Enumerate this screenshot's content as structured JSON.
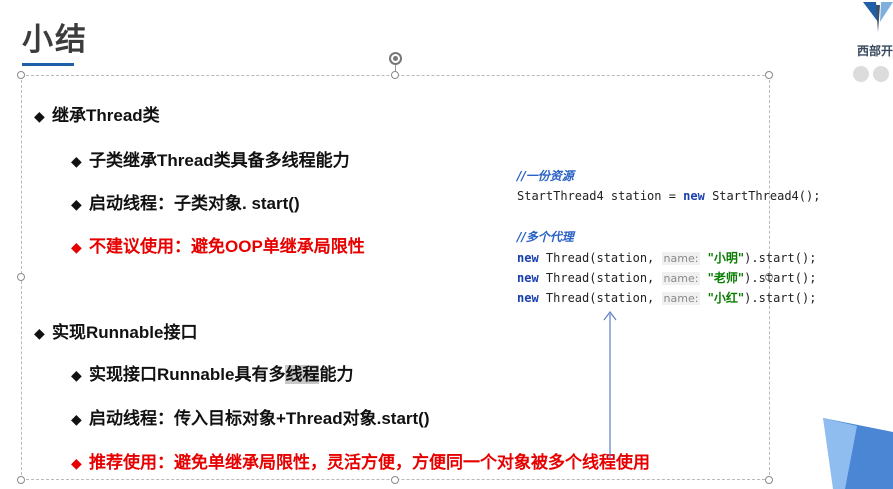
{
  "slide": {
    "title": "小结",
    "logo_text": "西部开"
  },
  "bullets": {
    "thread_heading": "继承Thread类",
    "thread_1": "子类继承Thread类具备多线程能力",
    "thread_2": "启动线程：子类对象. start()",
    "thread_3": "不建议使用：避免OOP单继承局限性",
    "runnable_heading": "实现Runnable接口",
    "runnable_1_a": "实现接口Runnable具有多",
    "runnable_1_b": "线程",
    "runnable_1_c": "能力",
    "runnable_2": "启动线程：传入目标对象+Thread对象.start()",
    "runnable_3": "推荐使用：避免单继承局限性，灵活方便，方便同一个对象被多个线程使用"
  },
  "bullet_marker": "◆",
  "code": {
    "comment_resource": "//一份资源",
    "line_station_a": "StartThread4 station = ",
    "kw_new": "new",
    "line_station_b": " StartThread4();",
    "comment_proxy": "//多个代理",
    "thread_call_a": " Thread(station, ",
    "hint_name": "name:",
    "arg_1": "\"小明\"",
    "arg_2": "\"老师\"",
    "arg_3": "\"小红\"",
    "call_tail": ").start();"
  },
  "colors": {
    "accent_blue": "#1f5fa8",
    "warning_red": "#e60000",
    "code_keyword": "#1a3fb0",
    "code_string": "#077d00",
    "code_comment": "#2b63c5"
  }
}
